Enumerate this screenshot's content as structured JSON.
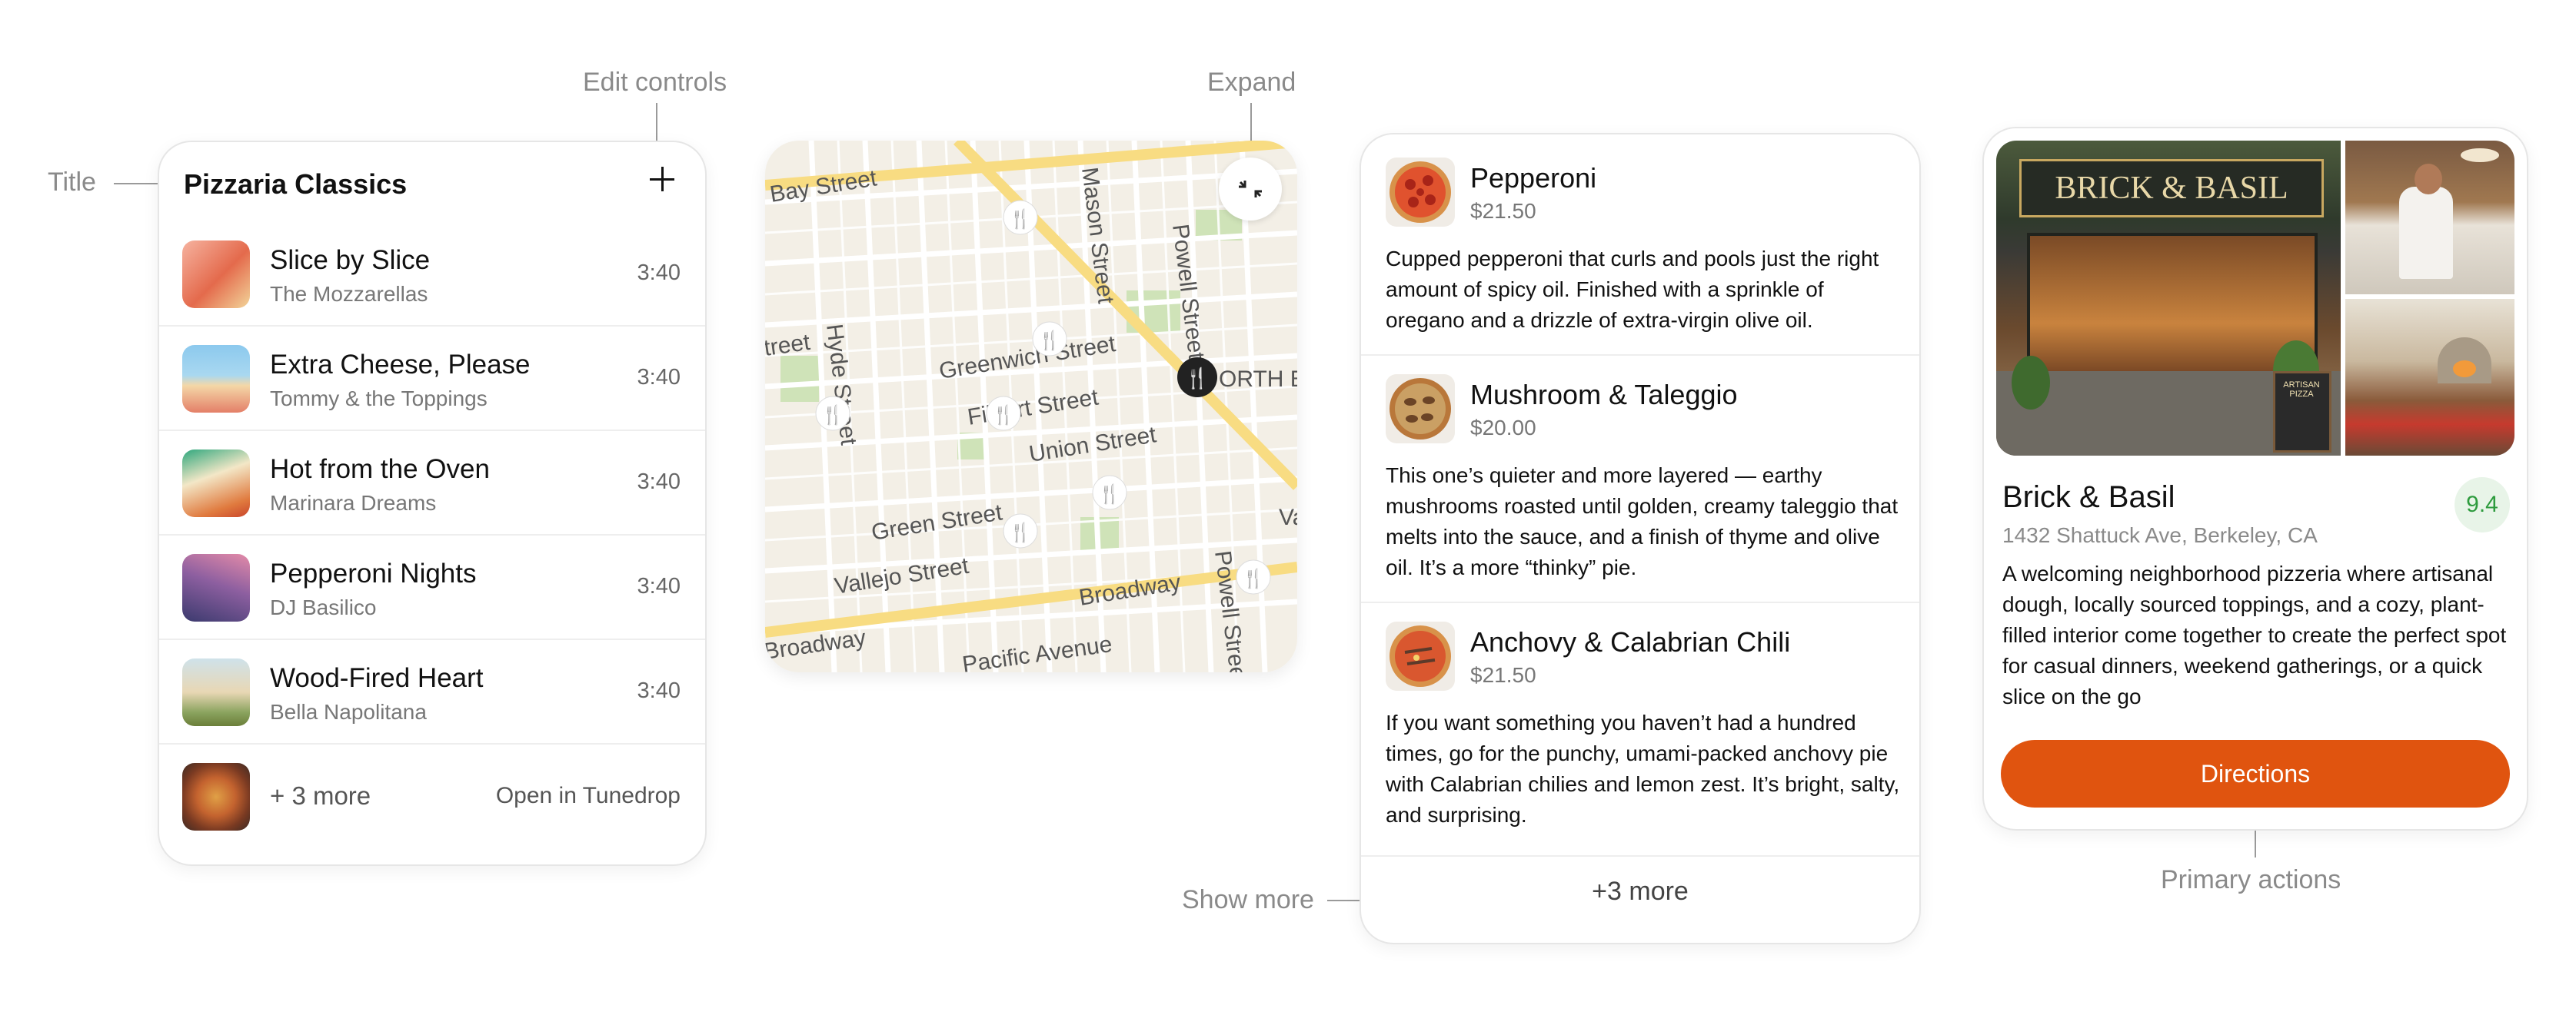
{
  "annotations": {
    "title": "Title",
    "edit_controls": "Edit controls",
    "expand": "Expand",
    "show_more": "Show more",
    "primary_actions": "Primary actions"
  },
  "playlist": {
    "title": "Pizzaria Classics",
    "tracks": [
      {
        "song": "Slice by Slice",
        "artist": "The Mozzarellas",
        "duration": "3:40"
      },
      {
        "song": "Extra Cheese, Please",
        "artist": "Tommy & the Toppings",
        "duration": "3:40"
      },
      {
        "song": "Hot from the Oven",
        "artist": "Marinara Dreams",
        "duration": "3:40"
      },
      {
        "song": "Pepperoni Nights",
        "artist": "DJ Basilico",
        "duration": "3:40"
      },
      {
        "song": "Wood-Fired Heart",
        "artist": "Bella Napolitana",
        "duration": "3:40"
      }
    ],
    "more_label": "+ 3 more",
    "open_label": "Open in Tunedrop"
  },
  "map": {
    "streets": [
      "Bay Street",
      "Mason Street",
      "Powell Street",
      "Hyde Street",
      "Greenwich Street",
      "Filbert Street",
      "Union Street",
      "Green Street",
      "Vallejo Street",
      "Broadway",
      "Broadway",
      "Pacific Avenue",
      "Powell Street"
    ],
    "partial_labels": [
      "treet",
      "ORTH B",
      "Va"
    ]
  },
  "menu": {
    "items": [
      {
        "name": "Pepperoni",
        "price": "$21.50",
        "description": "Cupped pepperoni that curls and pools just the right amount of spicy oil. Finished with a sprinkle of oregano and a drizzle of extra-virgin olive oil."
      },
      {
        "name": "Mushroom & Taleggio",
        "price": "$20.00",
        "description": "This one’s quieter and more layered — earthy mushrooms roasted until golden, creamy taleggio that melts into the sauce, and a finish of thyme and olive oil. It’s a more “thinky” pie."
      },
      {
        "name": "Anchovy & Calabrian Chili",
        "price": "$21.50",
        "description": "If you want something you haven’t had a hundred times, go for the punchy, umami-packed anchovy pie with Calabrian chilies and lemon zest. It’s bright, salty, and surprising."
      }
    ],
    "more_label": "+3 more"
  },
  "place": {
    "sign_text": "BRICK & BASIL",
    "chalkboard_text": "ARTISAN PIZZA",
    "name": "Brick & Basil",
    "address": "1432 Shattuck Ave, Berkeley, CA",
    "rating": "9.4",
    "description": "A welcoming neighborhood pizzeria where artisanal dough, locally sourced toppings, and a cozy, plant-filled interior come together to create the perfect spot for casual dinners, weekend gatherings, or a quick slice on the go",
    "button_label": "Directions"
  },
  "colors": {
    "accent": "#e0540f",
    "rating_green": "#2e9b3e",
    "map_bg": "#f3efe6",
    "map_major_road": "#f8dc82"
  }
}
